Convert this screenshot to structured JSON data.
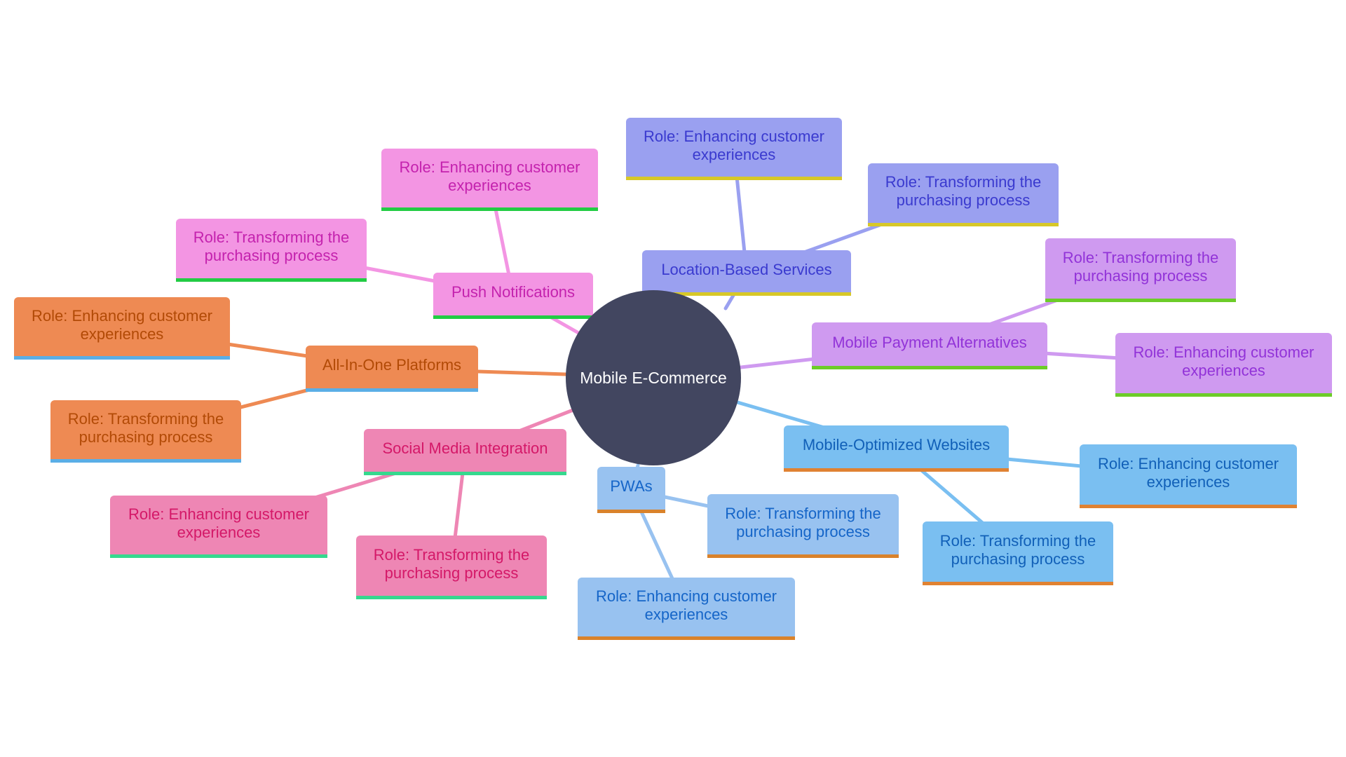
{
  "center": {
    "label": "Mobile E-Commerce",
    "color": "#424660"
  },
  "branches": [
    {
      "id": "location",
      "label": "Location-Based Services",
      "fill": "#9AA0F0",
      "text": "#3A3ACF",
      "border": "#D7C828",
      "edge": "#9AA0F0",
      "children": [
        "Role: Enhancing customer experiences",
        "Role: Transforming the purchasing process"
      ]
    },
    {
      "id": "push",
      "label": "Push Notifications",
      "fill": "#F395E3",
      "text": "#C422AE",
      "border": "#22CC44",
      "edge": "#F395E3",
      "children": [
        "Role: Enhancing customer experiences",
        "Role: Transforming the purchasing process"
      ]
    },
    {
      "id": "allinone",
      "label": "All-In-One Platforms",
      "fill": "#EE8A53",
      "text": "#B24A06",
      "border": "#5AAEE6",
      "edge": "#EE8A53",
      "children": [
        "Role: Enhancing customer experiences",
        "Role: Transforming the purchasing process"
      ]
    },
    {
      "id": "social",
      "label": "Social Media Integration",
      "fill": "#EE86B4",
      "text": "#D41868",
      "border": "#36D88E",
      "edge": "#EE86B4",
      "children": [
        "Role: Enhancing customer experiences",
        "Role: Transforming the purchasing process"
      ]
    },
    {
      "id": "pwas",
      "label": "PWAs",
      "fill": "#98C2F0",
      "text": "#1565C8",
      "border": "#D9822B",
      "edge": "#98C2F0",
      "children": [
        "Role: Transforming the purchasing process",
        "Role: Enhancing customer experiences"
      ]
    },
    {
      "id": "mobileopt",
      "label": "Mobile-Optimized Websites",
      "fill": "#7ABFF1",
      "text": "#1160B8",
      "border": "#E08232",
      "edge": "#7ABFF1",
      "children": [
        "Role: Enhancing customer experiences",
        "Role: Transforming the purchasing process"
      ]
    },
    {
      "id": "payment",
      "label": "Mobile Payment Alternatives",
      "fill": "#CF9AF0",
      "text": "#9233D8",
      "border": "#6CCC28",
      "edge": "#CF9AF0",
      "children": [
        "Role: Transforming the purchasing process",
        "Role: Enhancing customer experiences"
      ]
    }
  ]
}
